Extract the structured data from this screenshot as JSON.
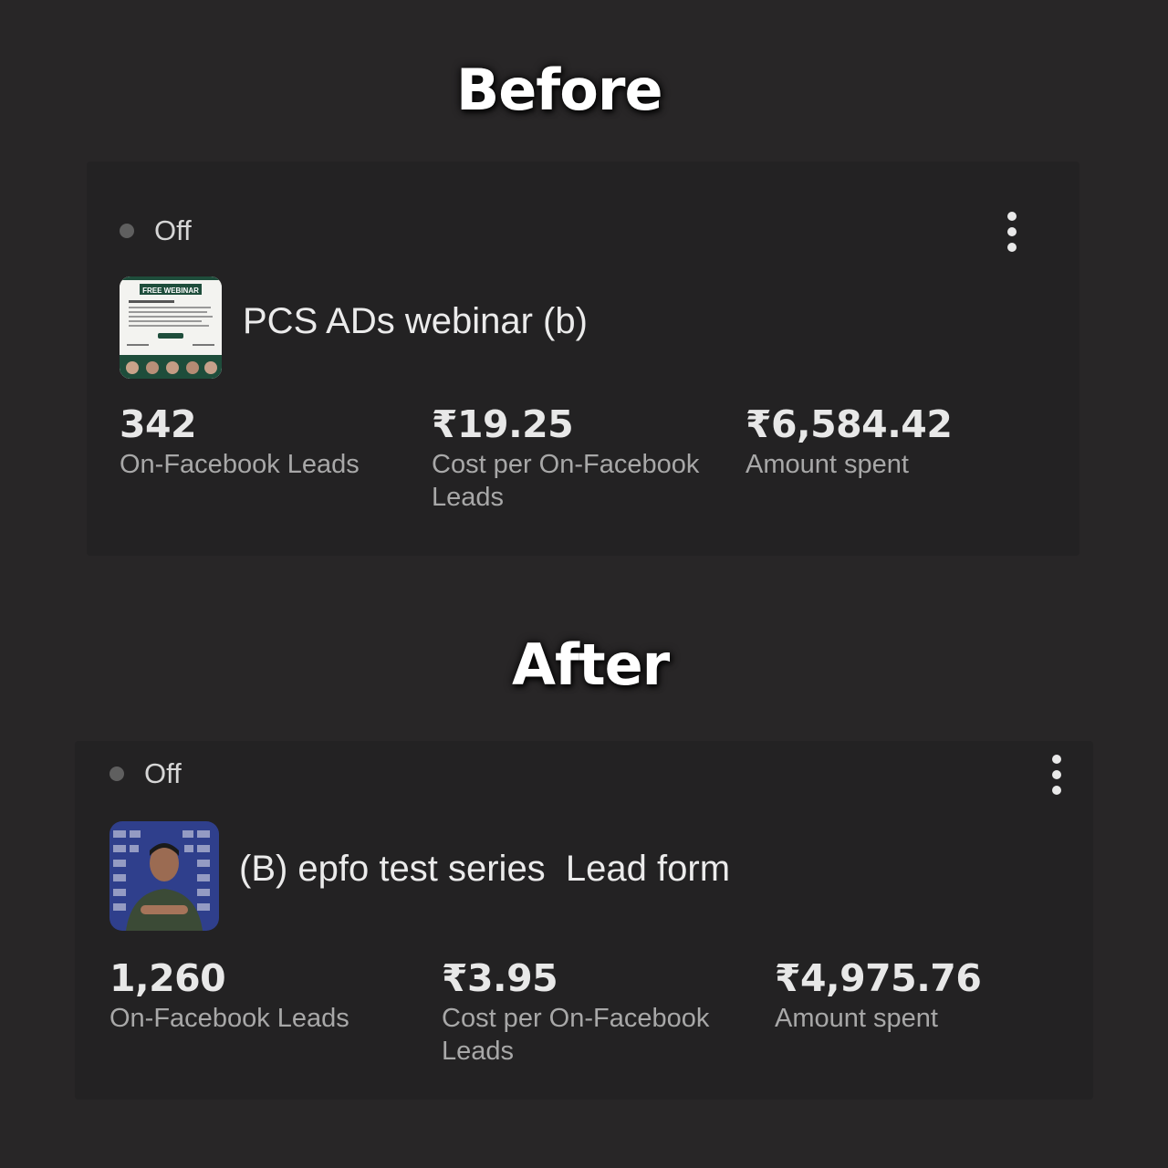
{
  "before": {
    "heading": "Before",
    "status": "Off",
    "ad_name": "PCS ADs webinar (b)",
    "thumbnail_text": "FREE WEBINAR",
    "metrics": [
      {
        "value": "342",
        "label": "On-Facebook Leads"
      },
      {
        "value": "₹19.25",
        "label": "Cost per On-Facebook Leads"
      },
      {
        "value": "₹6,584.42",
        "label": "Amount spent"
      }
    ]
  },
  "after": {
    "heading": "After",
    "status": "Off",
    "ad_name": "(B) epfo test series  Lead form",
    "metrics": [
      {
        "value": "1,260",
        "label": "On-Facebook Leads"
      },
      {
        "value": "₹3.95",
        "label": "Cost per On-Facebook Leads"
      },
      {
        "value": "₹4,975.76",
        "label": "Amount spent"
      }
    ]
  },
  "icons": {
    "menu": "more-vertical-icon",
    "status": "status-dot-icon"
  },
  "colors": {
    "background": "#282627",
    "card": "#232223",
    "status_dot": "#5f5f5f",
    "label": "#a8a8a8"
  }
}
